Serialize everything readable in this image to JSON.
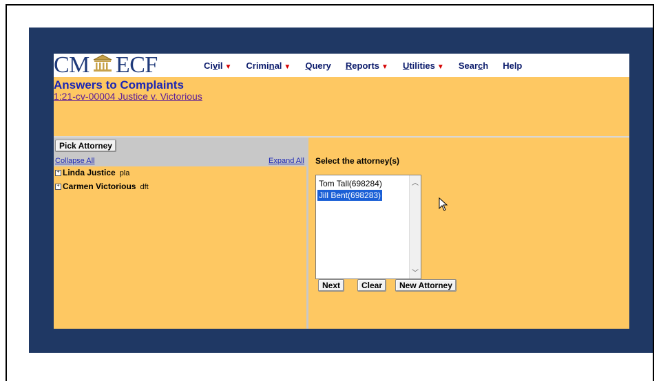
{
  "brand": {
    "left": "CM",
    "right": "ECF"
  },
  "menu": [
    {
      "label": "Civil",
      "underline_char": "v",
      "has_caret": true,
      "pre": "Ci",
      "post": "il"
    },
    {
      "label": "Criminal",
      "pre": "Crimi",
      "underline_char": "n",
      "post": "al",
      "has_caret": true
    },
    {
      "label": "Query",
      "pre": "",
      "underline_char": "Q",
      "post": "uery",
      "has_caret": false
    },
    {
      "label": "Reports",
      "pre": "",
      "underline_char": "R",
      "post": "eports",
      "has_caret": true
    },
    {
      "label": "Utilities",
      "pre": "",
      "underline_char": "U",
      "post": "tilities",
      "has_caret": true
    },
    {
      "label": "Search",
      "pre": "Sear",
      "underline_char": "c",
      "post": "h",
      "has_caret": false
    },
    {
      "label": "Help",
      "pre": "Help",
      "underline_char": "",
      "post": "",
      "has_caret": false
    }
  ],
  "header": {
    "title": "Answers to Complaints",
    "case_link": "1:21-cv-00004 Justice v. Victorious"
  },
  "left": {
    "pick_button": "Pick Attorney",
    "collapse_all": "Collapse All",
    "expand_all": "Expand All",
    "parties": [
      {
        "name": "Linda Justice",
        "role": "pla"
      },
      {
        "name": "Carmen Victorious",
        "role": "dft"
      }
    ]
  },
  "right": {
    "select_label": "Select the attorney(s)",
    "attorneys": [
      {
        "label": "Tom Tall(698284)",
        "selected": false
      },
      {
        "label": "Jill Bent(698283)",
        "selected": true
      }
    ],
    "buttons": {
      "next": "Next",
      "clear": "Clear",
      "new_attorney": "New Attorney"
    }
  },
  "colors": {
    "navy": "#1f3864",
    "gold": "#fec862",
    "link": "#1a25b5",
    "selection": "#1a5fd6"
  },
  "icons": {
    "tree_expand": "plus-box-icon",
    "scroll_up": "chevron-up-icon",
    "scroll_down": "chevron-down-icon",
    "pointer": "mouse-pointer-icon"
  }
}
